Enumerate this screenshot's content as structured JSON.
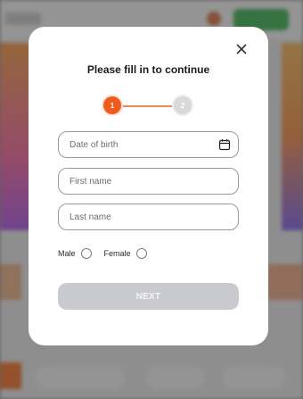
{
  "modal": {
    "title": "Please fill in to continue",
    "close_icon": "close-icon",
    "stepper": {
      "steps": [
        {
          "label": "1",
          "state": "active"
        },
        {
          "label": "2",
          "state": "inactive"
        }
      ],
      "active_color": "#f05a1c"
    },
    "fields": {
      "date_of_birth": {
        "placeholder": "Date of birth",
        "value": "",
        "icon": "calendar-icon"
      },
      "first_name": {
        "placeholder": "First name",
        "value": ""
      },
      "last_name": {
        "placeholder": "Last name",
        "value": ""
      }
    },
    "gender": {
      "options": [
        {
          "label": "Male",
          "selected": false
        },
        {
          "label": "Female",
          "selected": false
        }
      ]
    },
    "next_button": {
      "label": "NEXT",
      "enabled": false,
      "color": "#c9cad0"
    }
  }
}
